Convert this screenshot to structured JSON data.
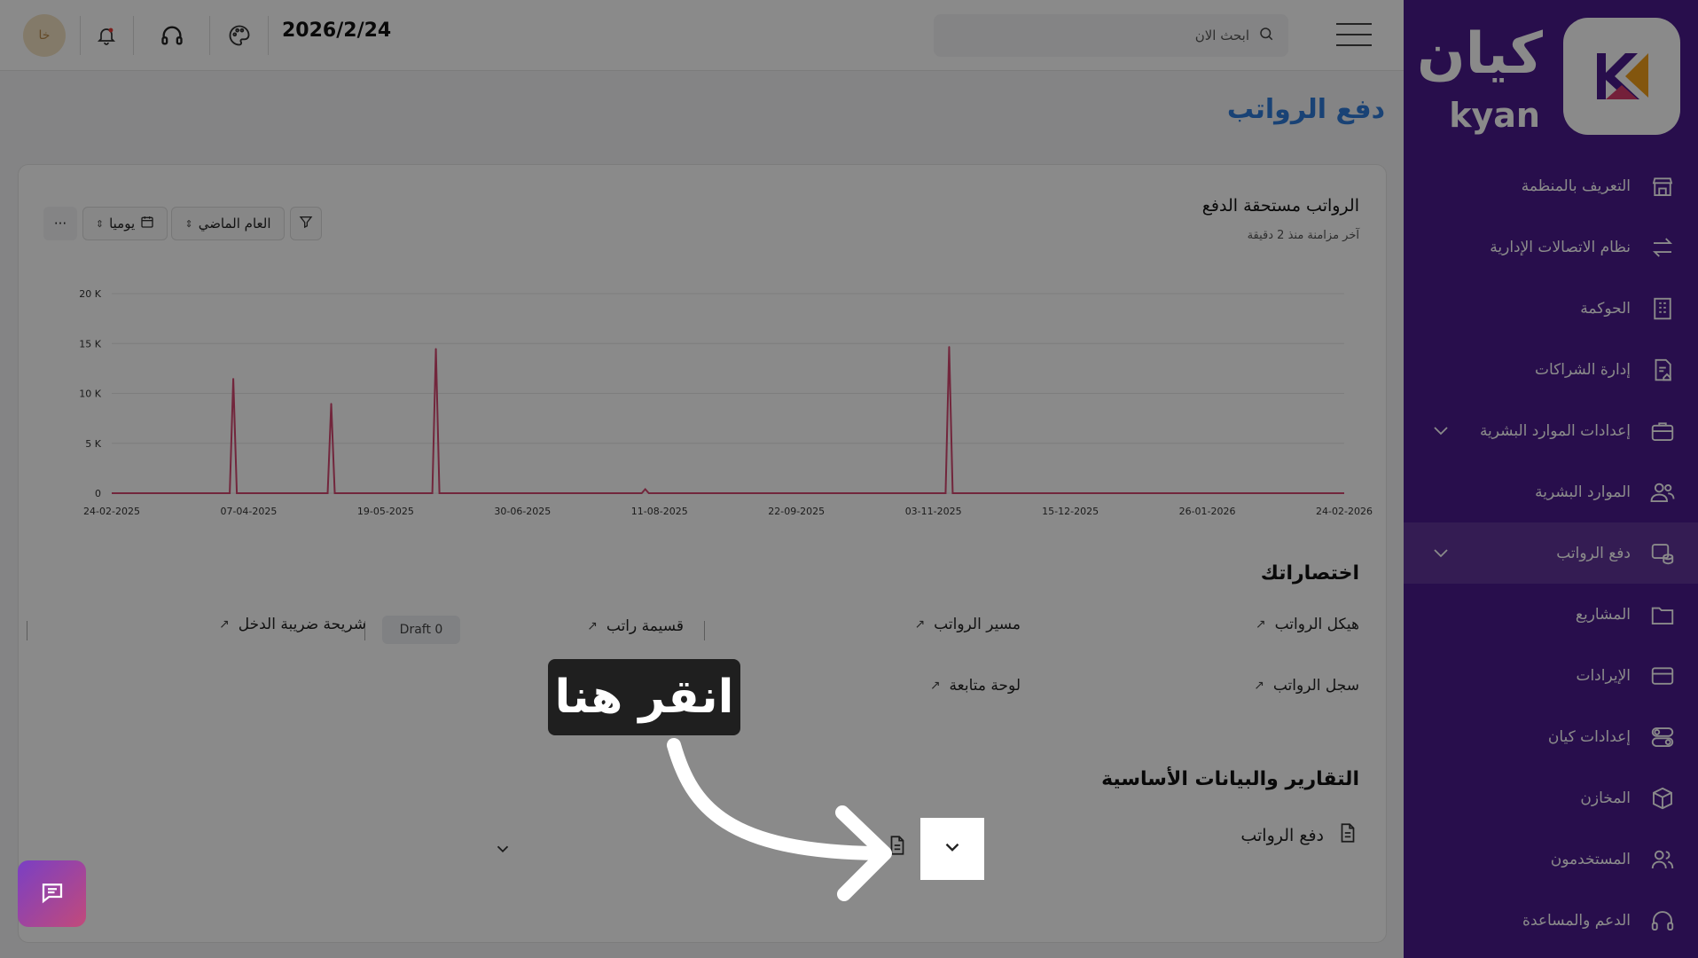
{
  "header": {
    "search_placeholder": "ابحث الان",
    "date": "2026/2/24",
    "avatar_initials": "خا"
  },
  "sidebar": {
    "logo_ar": "كيان",
    "logo_en": "kyan",
    "items": [
      {
        "label": "التعريف بالمنظمة",
        "icon": "store-icon"
      },
      {
        "label": "نظام الاتصالات الإدارية",
        "icon": "arrows-exchange-icon"
      },
      {
        "label": "الحوكمة",
        "icon": "building-icon"
      },
      {
        "label": "إدارة الشراكات",
        "icon": "document-home-icon"
      },
      {
        "label": "إعدادات الموارد البشرية",
        "icon": "briefcase-icon",
        "expandable": true
      },
      {
        "label": "الموارد البشرية",
        "icon": "users-icon"
      },
      {
        "label": "دفع الرواتب",
        "icon": "payroll-coins-icon",
        "expandable": true,
        "active": true
      },
      {
        "label": "المشاريع",
        "icon": "folder-icon"
      },
      {
        "label": "الإيرادات",
        "icon": "card-icon"
      },
      {
        "label": "إعدادات كيان",
        "icon": "toggles-icon"
      },
      {
        "label": "المخازن",
        "icon": "box-icon"
      },
      {
        "label": "المستخدمون",
        "icon": "user-group-icon"
      },
      {
        "label": "الدعم والمساعدة",
        "icon": "headset-icon"
      }
    ]
  },
  "page": {
    "title": "دفع الرواتب"
  },
  "chart_card": {
    "title": "الرواتب مستحقة الدفع",
    "subtitle": "آخر مزامنة منذ 2 دقيقة",
    "period_select": "العام الماضي",
    "interval_select": "يوميا",
    "more_label": "···"
  },
  "chart_data": {
    "type": "line",
    "x_tick_labels": [
      "24-02-2025",
      "07-04-2025",
      "19-05-2025",
      "30-06-2025",
      "11-08-2025",
      "22-09-2025",
      "03-11-2025",
      "15-12-2025",
      "26-01-2026",
      "24-02-2026"
    ],
    "y_tick_labels": [
      "0",
      "5 K",
      "10 K",
      "15 K",
      "20 K"
    ],
    "ylim": [
      0,
      20000
    ],
    "xlim": [
      "2025-02-24",
      "2026-02-24"
    ],
    "series": [
      {
        "color": "#d2466f",
        "points": [
          {
            "x": "2025-04-01",
            "y": 11500
          },
          {
            "x": "2025-04-30",
            "y": 9000
          },
          {
            "x": "2025-05-31",
            "y": 14500
          },
          {
            "x": "2025-08-01",
            "y": 400
          },
          {
            "x": "2025-10-30",
            "y": 14700
          }
        ],
        "baseline": 0
      }
    ],
    "grid": true
  },
  "shortcuts": {
    "title": "اختصاراتك",
    "items": [
      {
        "label": "هيكل الرواتب"
      },
      {
        "label": "مسير الرواتب"
      },
      {
        "label": "قسيمة راتب"
      },
      {
        "label": "شريحة ضريبة الدخل"
      },
      {
        "label": "سجل الرواتب"
      },
      {
        "label": "لوحة متابعة"
      }
    ],
    "draft_chip": "Draft 0"
  },
  "reports": {
    "title": "التقارير والبيانات الأساسية",
    "row_label": "دفع الرواتب"
  },
  "overlay": {
    "tooltip": "انقر هنا"
  },
  "colors": {
    "sidebar": "#4a1a8c",
    "title_blue": "#2f7ad9",
    "series": "#d2466f"
  }
}
